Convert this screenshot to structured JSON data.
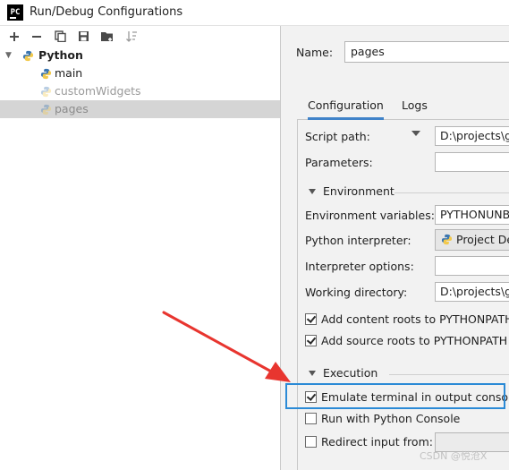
{
  "window": {
    "title": "Run/Debug Configurations",
    "app_icon_text": "PC"
  },
  "toolbar": {
    "buttons": [
      "add-icon",
      "remove-icon",
      "copy-icon",
      "save-icon",
      "folder-icon",
      "sort-icon"
    ]
  },
  "tree": {
    "root": {
      "label": "Python",
      "expanded": true
    },
    "children": [
      {
        "label": "main",
        "selected": false,
        "dimmed": false
      },
      {
        "label": "customWidgets",
        "selected": false,
        "dimmed": true
      },
      {
        "label": "pages",
        "selected": true,
        "dimmed": true
      }
    ]
  },
  "name_field": {
    "label": "Name:",
    "value": "pages"
  },
  "tabs": [
    {
      "label": "Configuration",
      "active": true
    },
    {
      "label": "Logs",
      "active": false
    }
  ],
  "fields": {
    "script_path": {
      "label": "Script path:",
      "value": "D:\\projects\\g"
    },
    "parameters": {
      "label": "Parameters:",
      "value": ""
    },
    "environment_section": "Environment",
    "env_vars": {
      "label": "Environment variables:",
      "value": "PYTHONUNB"
    },
    "interpreter": {
      "label": "Python interpreter:",
      "value": "Project De"
    },
    "interp_options": {
      "label": "Interpreter options:",
      "value": ""
    },
    "working_dir": {
      "label": "Working directory:",
      "value": "D:\\projects\\g"
    },
    "add_content_roots": {
      "label": "Add content roots to PYTHONPATH",
      "checked": true
    },
    "add_source_roots": {
      "label": "Add source roots to PYTHONPATH",
      "checked": true
    },
    "execution_section": "Execution",
    "emulate_terminal": {
      "label": "Emulate terminal in output console",
      "checked": true
    },
    "run_python_console": {
      "label": "Run with Python Console",
      "checked": false
    },
    "redirect_input": {
      "label": "Redirect input from:",
      "checked": false,
      "value": ""
    }
  },
  "watermark": "CSDN @悦沧Ⅹ",
  "colors": {
    "selection": "#d5d5d5",
    "tab_underline": "#4083c9",
    "highlight_box": "#2b8ad6",
    "annotation_arrow": "#e8352f"
  }
}
